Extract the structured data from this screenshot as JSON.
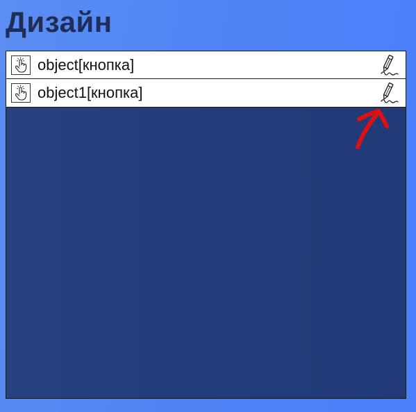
{
  "page": {
    "title": "Дизайн"
  },
  "objects": [
    {
      "label": "object[кнопка]",
      "type_icon": "tap-hand-icon",
      "action_icon": "edit-pencil-icon"
    },
    {
      "label": "object1[кнопка]",
      "type_icon": "tap-hand-icon",
      "action_icon": "edit-pencil-icon"
    }
  ],
  "colors": {
    "background": "#4f83f6",
    "panel": "#243f7b",
    "title": "#1f2d57",
    "annotation": "#e01010"
  }
}
